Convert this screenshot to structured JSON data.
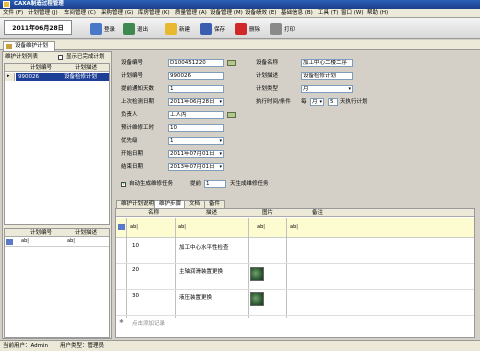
{
  "title": "CAXA制造过程管理",
  "menu": [
    "文件 (F)",
    "计划管理 (J)",
    "车间管理 (C)",
    "采购管理 (G)",
    "库房管理 (K)",
    "质量管理 (A)",
    "设备管理 (M)",
    "设备绩效 (E)",
    "基础信息 (B)",
    "工具 (T)",
    "窗口 (W)",
    "帮助 (H)"
  ],
  "toolbar": {
    "date": "2011年06月28日",
    "buttons": [
      "登录",
      "退出",
      "新建",
      "保存",
      "删除",
      "打印"
    ]
  },
  "tab_label": "设备维护计划",
  "left": {
    "list_title": "维护计划列表",
    "show_completed": "显示已完成计划",
    "col1": "计划编号",
    "col2": "计划描述",
    "row_code": "990026",
    "row_desc": "设备检修计划",
    "bottom_col1": "计划编号",
    "bottom_col2": "计划描述",
    "filter_icon": "filter-icon"
  },
  "form": {
    "device_code_label": "设备编号",
    "device_code": "D100451220",
    "device_name_label": "设备名称",
    "device_name": "加工中心二楼二序",
    "plan_code_label": "计划编号",
    "plan_code": "990026",
    "plan_desc_label": "计划描述",
    "plan_desc": "设备检修计划",
    "advance_days_label": "提前通知天数",
    "advance_days": "1",
    "plan_type_label": "计划类型",
    "plan_type": "月",
    "last_exec_label": "上次检测日期",
    "last_exec": "2011年06月28日",
    "exec_cond_label": "执行时间/条件",
    "exec_every": "每",
    "exec_unit": "月",
    "exec_num": "5",
    "exec_tail": "天执行计划",
    "owner_label": "负责人",
    "owner": "工人丙",
    "hours_label": "预计维修工时",
    "hours": "10",
    "priority_label": "优先级",
    "priority": "1",
    "start_label": "开始日期",
    "start": "2011年07月01日",
    "end_label": "结束日期",
    "end": "2013年07月01日",
    "auto_label": "自动生成维修任务",
    "ahead_label": "提前",
    "ahead": "1",
    "ahead_tail": "天生成维修任务"
  },
  "subtabs": [
    "维护计划说明",
    "维护步骤",
    "文档",
    "备件"
  ],
  "steps": {
    "cols": [
      "名称",
      "描述",
      "图片",
      "备注"
    ],
    "rows": [
      {
        "no": "10",
        "desc": "加工中心水平性检查"
      },
      {
        "no": "20",
        "desc": "主轴润滑装置更换"
      },
      {
        "no": "30",
        "desc": "液压装置更换"
      }
    ],
    "add_hint": "点击添加记录"
  },
  "status": {
    "user": "当前用户：Admin",
    "type": "用户类型：管理员"
  }
}
